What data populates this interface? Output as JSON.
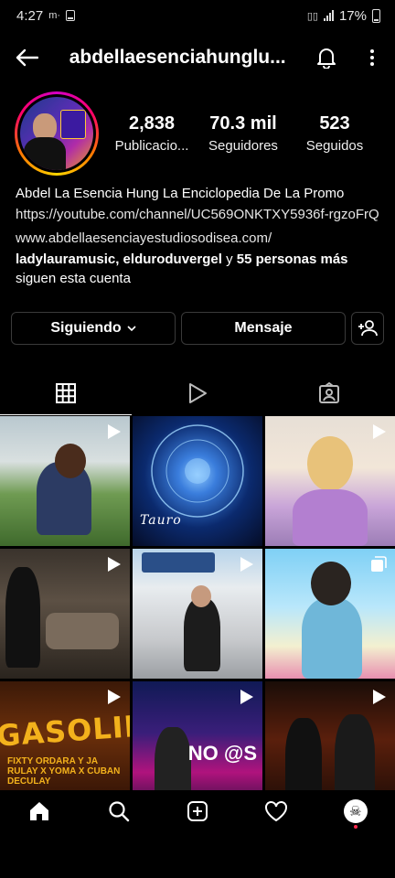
{
  "status_bar": {
    "time": "4:27",
    "notif_icons": "m·",
    "battery": "17%"
  },
  "header": {
    "username": "abdellaesenciahunglu..."
  },
  "profile": {
    "stats": [
      {
        "value": "2,838",
        "label": "Publicacio..."
      },
      {
        "value": "70.3 mil",
        "label": "Seguidores"
      },
      {
        "value": "523",
        "label": "Seguidos"
      }
    ],
    "bio": {
      "name": "Abdel La Esencia Hung La Enciclopedia De La Promo",
      "link1": "https://youtube.com/channel/UC569ONKTXY5936f-rgzoFrQ",
      "link2": "www.abdellaesenciayestudiosodisea.com/",
      "followed_by_users": "ladylauramusic, elduroduvergel",
      "followed_by_mid": " y ",
      "followed_by_count": "55 personas más",
      "followed_by_tail": "siguen esta cuenta"
    }
  },
  "actions": {
    "following_label": "Siguiendo",
    "message_label": "Mensaje"
  },
  "tabs": [
    "grid",
    "reels",
    "tagged"
  ],
  "grid": {
    "posts": [
      {
        "type": "reel",
        "caption": ""
      },
      {
        "type": "image",
        "caption": "Tauro"
      },
      {
        "type": "reel",
        "caption": ""
      },
      {
        "type": "reel",
        "caption": ""
      },
      {
        "type": "reel",
        "caption": ""
      },
      {
        "type": "carousel",
        "caption": ""
      },
      {
        "type": "reel",
        "caption": "GASOLINA",
        "subcaption": "FIXTY ORDARA Y JA RULAY X YOMA X CUBAN DECULAY"
      },
      {
        "type": "reel",
        "caption": "NO @S"
      },
      {
        "type": "reel",
        "caption": ""
      }
    ]
  },
  "bottom_nav": [
    "home-icon",
    "search-icon",
    "new-post-icon",
    "heart-icon",
    "profile-avatar"
  ],
  "colors": {
    "background": "#000000",
    "text": "#ffffff",
    "button_border": "#3a3a3a",
    "story_ring": [
      "#d300c5",
      "#ff0069",
      "#ffd600"
    ],
    "notification_dot": "#ff2a4f"
  }
}
